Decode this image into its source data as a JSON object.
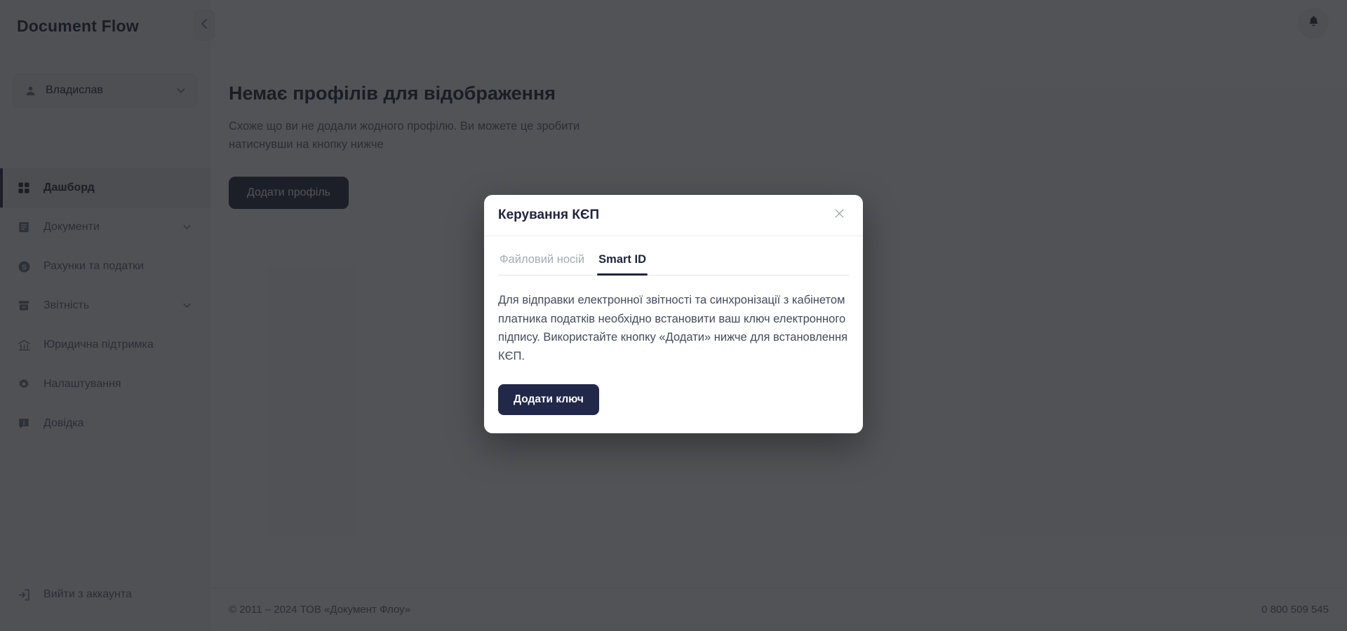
{
  "sidebar": {
    "brand": "Document Flow",
    "collapse_icon": "chevron-left-icon",
    "user": {
      "name": "Владислав",
      "avatar_icon": "person-icon",
      "chevron_icon": "chevron-down-icon"
    },
    "items": [
      {
        "label": "Дашборд",
        "icon": "grid-icon",
        "active": true,
        "expandable": false
      },
      {
        "label": "Документи",
        "icon": "document-icon",
        "active": false,
        "expandable": true
      },
      {
        "label": "Рахунки та податки",
        "icon": "dollar-icon",
        "active": false,
        "expandable": false
      },
      {
        "label": "Звітність",
        "icon": "archive-icon",
        "active": false,
        "expandable": true
      },
      {
        "label": "Юридична підтримка",
        "icon": "bank-icon",
        "active": false,
        "expandable": false
      },
      {
        "label": "Налаштування",
        "icon": "gear-icon",
        "active": false,
        "expandable": false
      },
      {
        "label": "Довідка",
        "icon": "info-icon",
        "active": false,
        "expandable": false
      }
    ],
    "logout": {
      "label": "Вийти з аккаунта",
      "icon": "logout-icon"
    }
  },
  "topbar": {
    "notifications_icon": "bell-icon"
  },
  "main": {
    "empty_title": "Немає профілів для відображення",
    "empty_subtitle": "Схоже що ви не додали жодного профілю. Ви можете це зробити натиснувши на кнопку нижче",
    "add_profile_label": "Додати профіль"
  },
  "footer": {
    "copyright": "© 2011 – 2024 ТОВ «Документ Флоу»",
    "phone": "0 800 509 545"
  },
  "modal": {
    "title": "Керування КЄП",
    "close_icon": "close-icon",
    "tabs": [
      {
        "label": "Файловий носій",
        "active": false
      },
      {
        "label": "Smart ID",
        "active": true
      }
    ],
    "body_text": "Для відправки електронної звітності та синхронізації з кабінетом платника податків необхідно встановити ваш ключ електронного підпису. Використайте кнопку «Додати» нижче для встановлення КЄП.",
    "action_label": "Додати ключ"
  },
  "colors": {
    "accent_dark": "#1f2440",
    "modal_button": "#22284a",
    "sidebar_bg": "#f5f6f8",
    "overlay": "rgba(27,29,33,0.76)"
  }
}
